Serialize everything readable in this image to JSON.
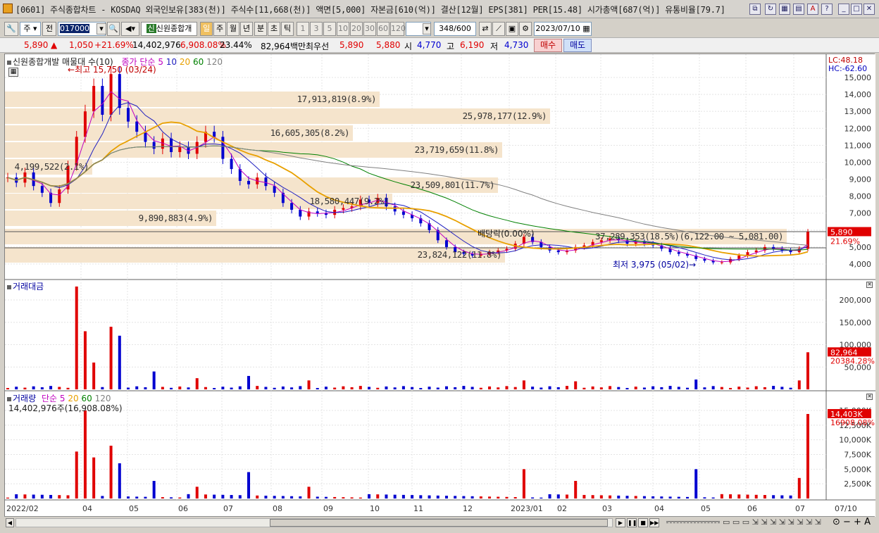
{
  "window": {
    "title": "[0601] 주식종합차트 - KOSDAQ 외국인보유[383(천)] 주식수[11,668(천)] 액면[5,000] 자본금[610(억)] 결산[12월] EPS[381] PER[15.48] 시가총액[687(억)] 유통비율[79.7]"
  },
  "toolbar": {
    "type_select": "주",
    "period_label": "전",
    "code_value": "017000",
    "stock_name": "신원종합개",
    "chart_tab_selected": "일",
    "period_tabs": [
      "주",
      "월",
      "년",
      "분",
      "초",
      "틱"
    ],
    "interval_buttons": [
      "1",
      "3",
      "5",
      "10",
      "20",
      "30",
      "60",
      "120"
    ],
    "count_value": "348",
    "count_total": "/600",
    "date_value": "2023/07/10"
  },
  "quote": {
    "price": "5,890",
    "change": "1,050",
    "change_pct": "+21.69%",
    "volume": "14,402,976",
    "volume_pct": "6,908.08%",
    "turnover": "23.44%",
    "trade_value": "82,964백만",
    "best_label": "최우선",
    "ask": "5,890",
    "bid": "5,880",
    "open_label": "시",
    "open": "4,770",
    "high_label": "고",
    "high": "6,190",
    "low_label": "저",
    "low": "4,730",
    "buy_label": "매수",
    "sell_label": "매도"
  },
  "price_pane": {
    "title": "신원종합개발 매물대 수(10)",
    "ma_label": "종가 단순",
    "ma_periods": [
      "5",
      "10",
      "20",
      "60",
      "120"
    ],
    "ma_colors": [
      "#c000c0",
      "#2020c0",
      "#e8a000",
      "#008000",
      "#808080"
    ],
    "high_note": "최고 15,750 (03/24)",
    "low_note": "최저 3,975 (05/02)",
    "dividend_note": "배당락(0.00%)",
    "lc": "LC:48.18",
    "hc": "HC:-62.60",
    "last_price": "5,890",
    "last_pct": "21.69%",
    "y_ticks": [
      "15,000",
      "14,000",
      "13,000",
      "12,000",
      "11,000",
      "10,000",
      "9,000",
      "8,000",
      "7,000",
      "6,000",
      "5,000",
      "4,000"
    ],
    "bands": [
      {
        "label": "17,913,819(8.9%)"
      },
      {
        "label": "25,978,177(12.9%)"
      },
      {
        "label": "16,605,305(8.2%)"
      },
      {
        "label": "23,719,659(11.8%)"
      },
      {
        "label": "4,199,522(2.1%)"
      },
      {
        "label": "23,509,801(11.7%)"
      },
      {
        "label": "18,580,447(9.2%)"
      },
      {
        "label": "9,890,883(4.9%)"
      },
      {
        "label": "37,289,353(18.5%)(6,122.00 ~ 5,081.00)"
      },
      {
        "label": "23,824,122(11.8%)"
      }
    ]
  },
  "value_pane": {
    "title": "거래대금",
    "y_ticks": [
      "200,000",
      "150,000",
      "100,000",
      "50,000"
    ],
    "last_value": "82,964",
    "last_pct": "20384.28%"
  },
  "volume_pane": {
    "title": "거래량",
    "ma_label": "단순",
    "ma_periods": [
      "5",
      "20",
      "60",
      "120"
    ],
    "ma_colors": [
      "#c000c0",
      "#e8a000",
      "#008000",
      "#808080"
    ],
    "summary": "14,402,976주(16,908.08%)",
    "y_ticks": [
      "15,000K",
      "12,500K",
      "10,000K",
      "7,500K",
      "5,000K",
      "2,500K"
    ],
    "last_value": "14,403K",
    "last_pct": "16908.08%"
  },
  "x_axis": {
    "labels": [
      "2022/02",
      "04",
      "05",
      "06",
      "07",
      "08",
      "09",
      "10",
      "11",
      "12",
      "2023/01",
      "02",
      "03",
      "04",
      "05",
      "06",
      "07"
    ],
    "right_label": "07/10"
  },
  "colors": {
    "up": "#e00000",
    "down": "#0000d0",
    "accent": "#e00000",
    "band": "#f5e4cc"
  }
}
